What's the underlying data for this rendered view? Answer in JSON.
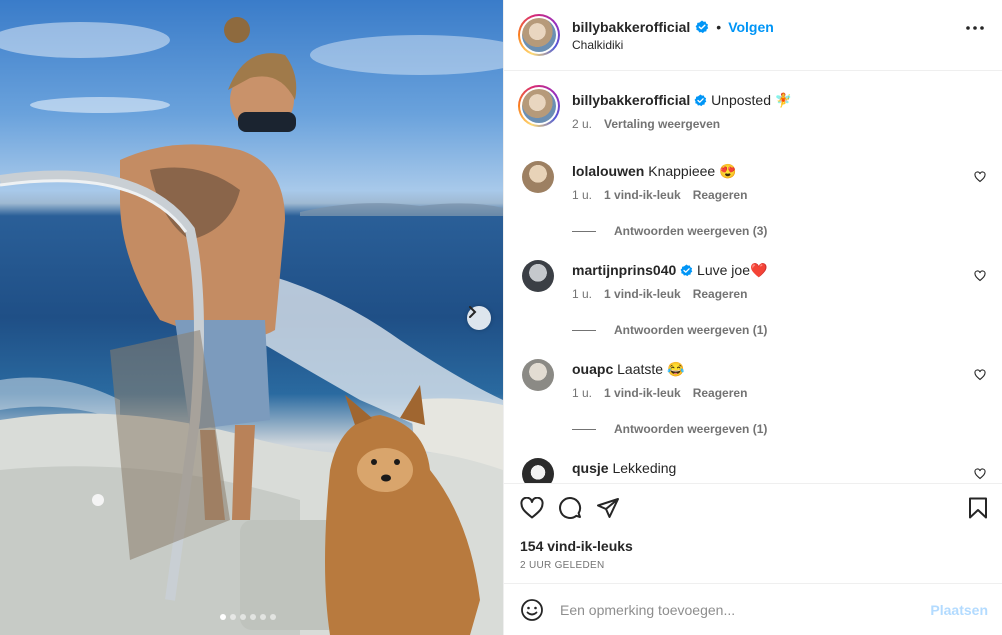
{
  "media": {
    "carousel_dots": 6,
    "active_dot": 0,
    "next_icon": "chevron-right-icon"
  },
  "header": {
    "username": "billybakkerofficial",
    "separator": "•",
    "follow_label": "Volgen",
    "location": "Chalkidiki",
    "more_icon": "more-horizontal-icon"
  },
  "caption": {
    "username": "billybakkerofficial",
    "text": "Unposted 🧚",
    "time": "2 u.",
    "translate_label": "Vertaling weergeven"
  },
  "comments": [
    {
      "username": "lolalouwen",
      "verified": false,
      "text": "Knappieee 😍",
      "time": "1 u.",
      "likes": "1 vind-ik-leuk",
      "reply": "Reageren",
      "replies": "Antwoorden weergeven (3)"
    },
    {
      "username": "martijnprins040",
      "verified": true,
      "text": "Luve joe❤️",
      "time": "1 u.",
      "likes": "1 vind-ik-leuk",
      "reply": "Reageren",
      "replies": "Antwoorden weergeven (1)"
    },
    {
      "username": "ouapc",
      "verified": false,
      "text": "Laatste 😂",
      "time": "1 u.",
      "likes": "1 vind-ik-leuk",
      "reply": "Reageren",
      "replies": "Antwoorden weergeven (1)"
    },
    {
      "username": "qusje",
      "verified": false,
      "text": "Lekkeding"
    }
  ],
  "actions": {
    "like_icon": "heart-icon",
    "comment_icon": "comment-icon",
    "share_icon": "send-icon",
    "save_icon": "bookmark-icon",
    "likes_count": "154 vind-ik-leuks",
    "posted_time": "2 UUR GELEDEN"
  },
  "add_comment": {
    "emoji_icon": "emoji-icon",
    "placeholder": "Een opmerking toevoegen...",
    "post_label": "Plaatsen"
  },
  "colors": {
    "accent": "#0095f6",
    "post_disabled": "#b3dbff",
    "text": "#262626",
    "muted": "#737373"
  }
}
